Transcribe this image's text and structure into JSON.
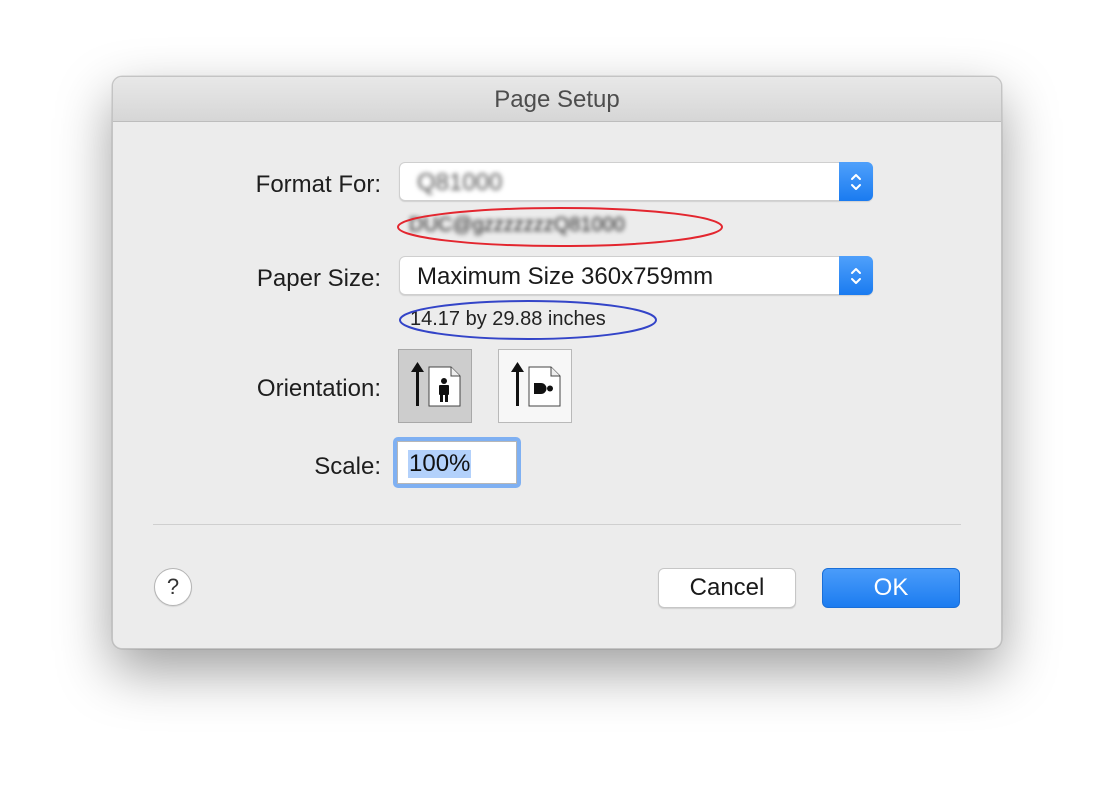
{
  "dialog": {
    "title": "Page Setup"
  },
  "format_for": {
    "label": "Format For:",
    "value": "Q81000",
    "detail": "DUC@gzzzzzzzQ81000"
  },
  "paper_size": {
    "label": "Paper Size:",
    "value": "Maximum Size 360x759mm",
    "dimensions": "14.17 by 29.88 inches"
  },
  "orientation": {
    "label": "Orientation:",
    "options": [
      "portrait",
      "landscape"
    ],
    "selected": "portrait"
  },
  "scale": {
    "label": "Scale:",
    "value": "100%"
  },
  "buttons": {
    "help": "?",
    "cancel": "Cancel",
    "ok": "OK"
  },
  "annotations": {
    "red_circle_color": "#e3262f",
    "blue_circle_color": "#3344c8"
  },
  "colors": {
    "accent": "#1c7cf0"
  }
}
